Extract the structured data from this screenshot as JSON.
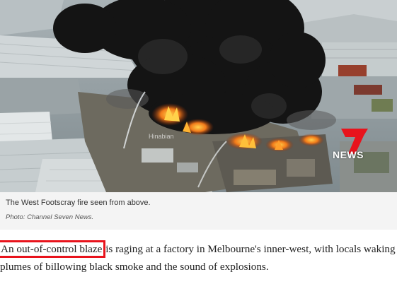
{
  "image": {
    "alt": "Aerial view of a factory fire with black smoke in West Footscray",
    "news_logo": {
      "number": "7",
      "label": "NEWS",
      "color": "#e8131c"
    },
    "watermark": "Hinabian"
  },
  "caption": {
    "text": "The West Footscray fire seen from above.",
    "credit": "Photo: Channel Seven News."
  },
  "article": {
    "highlight": "An out-of-control blaze",
    "line1_rest": " is raging at a factory in Melbourne's inner-west, with locals waking to",
    "line2": "plumes of billowing black smoke and the sound of explosions."
  }
}
